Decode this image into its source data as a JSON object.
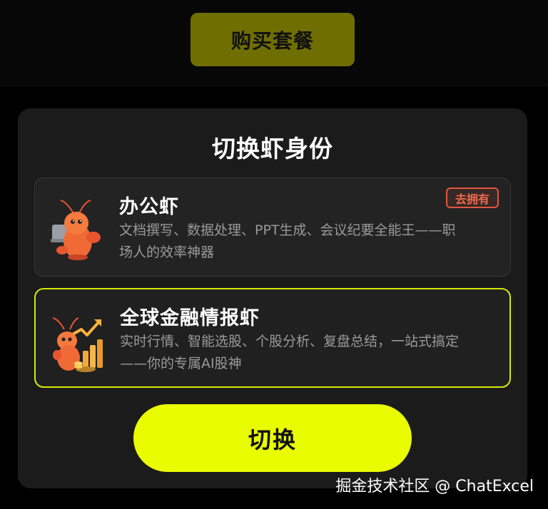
{
  "top": {
    "buy_label": "购买套餐"
  },
  "sheet": {
    "title": "切换虾身份",
    "switch_label": "切换"
  },
  "cards": [
    {
      "title": "办公虾",
      "desc": "文档撰写、数据处理、PPT生成、会议纪要全能王——职\n场人的效率神器",
      "badge": "去拥有",
      "icon": "lobster-laptop-icon",
      "selected": false
    },
    {
      "title": "全球金融情报虾",
      "desc": "实时行情、智能选股、个股分析、复盘总结，一站式搞定\n——你的专属AI股神",
      "icon": "lobster-finance-icon",
      "selected": true
    }
  ],
  "watermark": "掘金技术社区 @ ChatExcel",
  "colors": {
    "accent": "#eafd00",
    "badge": "#e0573f",
    "sheet_bg": "#1b1b1b",
    "card_bg": "#232323"
  }
}
